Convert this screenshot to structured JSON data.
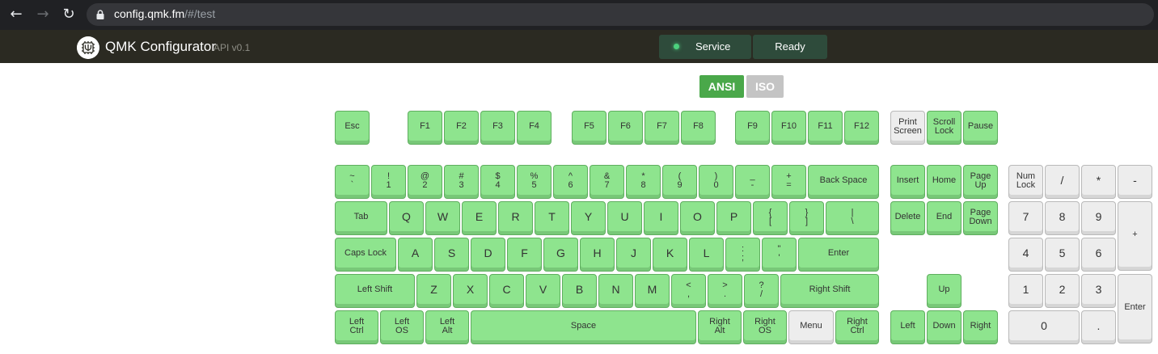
{
  "browser": {
    "back_icon": "arrow-left-icon",
    "forward_icon": "arrow-right-icon",
    "reload_icon": "reload-icon",
    "url_host": "config.qmk.fm",
    "url_path": "/#/test"
  },
  "app": {
    "title": "QMK Configurator",
    "api_version": "API v0.1",
    "status_label": "Service",
    "status_value": "Ready",
    "colors": {
      "header": "#2b2a22",
      "status": "#2e4b3b",
      "status_dot": "#4cd07d"
    }
  },
  "layout_toggle": {
    "ansi": "ANSI",
    "iso": "ISO",
    "selected": "ANSI"
  },
  "colors": {
    "key_pressed": "#8ee48e",
    "key_unpressed": "#ededed",
    "ansi_active": "#4aa84a"
  },
  "keys": {
    "esc": "Esc",
    "f1": "F1",
    "f2": "F2",
    "f3": "F3",
    "f4": "F4",
    "f5": "F5",
    "f6": "F6",
    "f7": "F7",
    "f8": "F8",
    "f9": "F9",
    "f10": "F10",
    "f11": "F11",
    "f12": "F12",
    "print_screen": "Print\nScreen",
    "scroll_lock": "Scroll\nLock",
    "pause": "Pause",
    "grave": "~\n`",
    "n1": "!\n1",
    "n2": "@\n2",
    "n3": "#\n3",
    "n4": "$\n4",
    "n5": "%\n5",
    "n6": "^\n6",
    "n7": "&\n7",
    "n8": "*\n8",
    "n9": "(\n9",
    "n0": ")\n0",
    "minus": "_\n-",
    "equal": "+\n=",
    "backspace": "Back Space",
    "insert": "Insert",
    "home": "Home",
    "page_up": "Page\nUp",
    "num_lock": "Num\nLock",
    "kp_slash": "/",
    "kp_star": "*",
    "kp_minus": "-",
    "tab": "Tab",
    "q": "Q",
    "w": "W",
    "e": "E",
    "r": "R",
    "t": "T",
    "y": "Y",
    "u": "U",
    "i": "I",
    "o": "O",
    "p": "P",
    "lbracket": "{\n[",
    "rbracket": "}\n]",
    "backslash": "|\n\\",
    "delete": "Delete",
    "end": "End",
    "page_down": "Page\nDown",
    "kp7": "7",
    "kp8": "8",
    "kp9": "9",
    "kp_plus": "+",
    "caps_lock": "Caps Lock",
    "a": "A",
    "s": "S",
    "d": "D",
    "f": "F",
    "g": "G",
    "h": "H",
    "j": "J",
    "k": "K",
    "l": "L",
    "semicolon": ":\n;",
    "quote": "\"\n'",
    "enter": "Enter",
    "kp4": "4",
    "kp5": "5",
    "kp6": "6",
    "left_shift": "Left Shift",
    "z": "Z",
    "x": "X",
    "c": "C",
    "v": "V",
    "b": "B",
    "n": "N",
    "m": "M",
    "comma": "<\n,",
    "period": ">\n.",
    "slash": "?\n/",
    "right_shift": "Right Shift",
    "up": "Up",
    "kp1": "1",
    "kp2": "2",
    "kp3": "3",
    "kp_enter": "Enter",
    "left_ctrl": "Left\nCtrl",
    "left_os": "Left\nOS",
    "left_alt": "Left\nAlt",
    "space": "Space",
    "right_alt": "Right\nAlt",
    "right_os": "Right\nOS",
    "menu": "Menu",
    "right_ctrl": "Right\nCtrl",
    "left": "Left",
    "down": "Down",
    "right": "Right",
    "kp0": "0",
    "kp_dot": "."
  }
}
